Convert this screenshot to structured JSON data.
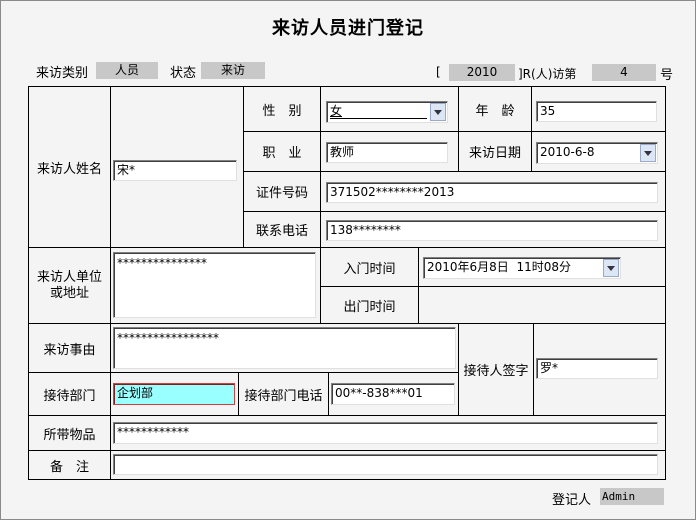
{
  "title": "来访人员进门登记",
  "header": {
    "visitor_type_label": "来访类别",
    "visitor_type_value": "人员",
    "status_label": "状态",
    "status_value": "来访",
    "bracket_open": "[",
    "year": "2010",
    "seq_mid": "]R(人)访第",
    "seq_number": "4",
    "seq_suffix": "号"
  },
  "form": {
    "name_label": "来访人姓名",
    "name_value": "宋*",
    "gender_label": "性　别",
    "gender_value": "女",
    "age_label": "年　龄",
    "age_value": "35",
    "job_label": "职　业",
    "job_value": "教师",
    "visit_date_label": "来访日期",
    "visit_date_value": "2010-6-8",
    "id_label": "证件号码",
    "id_value": "371502********2013",
    "phone_label": "联系电话",
    "phone_value": "138********",
    "unit_label_line1": "来访人单位",
    "unit_label_line2": "或地址",
    "unit_value": "***************",
    "enter_time_label": "入门时间",
    "enter_time_value": "2010年6月8日  11时08分",
    "exit_time_label": "出门时间",
    "reason_label": "来访事由",
    "reason_value": "*****************",
    "receiver_sign_label": "接待人签字",
    "receiver_sign_value": "罗*",
    "dept_label": "接待部门",
    "dept_value": "企划部",
    "dept_phone_label": "接待部门电话",
    "dept_phone_value": "00**-838***01",
    "items_label": "所带物品",
    "items_value": "************",
    "remark_label": "备　注",
    "remark_value": ""
  },
  "footer": {
    "registrar_label": "登记人",
    "registrar_value": "Admin"
  },
  "colors": {
    "dept_highlight": "#99ffff",
    "dept_border": "#d04040"
  }
}
